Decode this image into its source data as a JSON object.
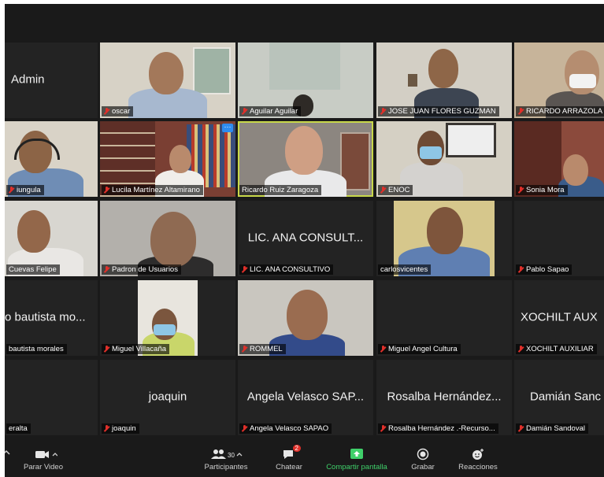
{
  "tiles": [
    {
      "big": "Admin"
    },
    {
      "tag": "oscar"
    },
    {
      "tag": "Aguilar Aguilar"
    },
    {
      "tag": "JOSE JUAN FLORES GUZMAN"
    },
    {
      "tag": "RICARDO ARRAZOLA"
    },
    {
      "tag": "iungula"
    },
    {
      "tag": "Lucila Martínez Altamirano"
    },
    {
      "tag": "Ricardo Ruiz Zaragoza"
    },
    {
      "tag": "ENOC"
    },
    {
      "tag": "Sonia Mora"
    },
    {
      "tag": "Cuevas Felipe"
    },
    {
      "tag": "Padron de Usuarios"
    },
    {
      "big": "LIC. ANA CONSULT...",
      "tag": "LIC. ANA CONSULTIVO"
    },
    {
      "tag": "carlosvicentes"
    },
    {
      "tag": "Pablo Sapao"
    },
    {
      "big": "o bautista mo...",
      "tag": "bautista morales"
    },
    {
      "tag": "Miguel Villacaña"
    },
    {
      "tag": "ROMMEL"
    },
    {
      "tag": "Miguel Angel Cultura"
    },
    {
      "big": "XOCHILT AUX",
      "tag": "XOCHILT AUXILIAR"
    },
    {
      "tag": "eralta"
    },
    {
      "big": "joaquin",
      "tag": "joaquin"
    },
    {
      "big": "Angela Velasco SAP...",
      "tag": "Angela Velasco SAPAO"
    },
    {
      "big": "Rosalba Hernández...",
      "tag": "Rosalba Hernández .-Recurso..."
    },
    {
      "big": "Damián Sanc",
      "tag": "Damián Sandoval"
    }
  ],
  "toolbar": {
    "video": "Parar Video",
    "participants": "Participantes",
    "participants_count": "30",
    "chat": "Chatear",
    "chat_badge": "2",
    "share": "Compartir pantalla",
    "record": "Grabar",
    "reactions": "Reacciones"
  },
  "colors": {
    "active_border": "#c8d84a",
    "muted_mic": "#e0302a",
    "share_green": "#3fd06a",
    "more_button": "#2e8cf0"
  }
}
